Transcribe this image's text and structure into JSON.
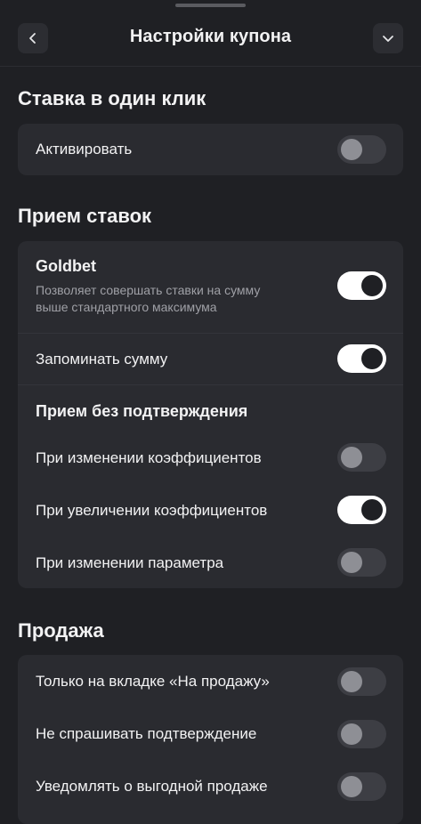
{
  "header": {
    "title": "Настройки купона",
    "back_icon": "chevron-left-icon",
    "collapse_icon": "chevron-down-icon"
  },
  "one_click": {
    "title": "Ставка в один клик",
    "activate_label": "Активировать",
    "activate_on": false
  },
  "accept": {
    "title": "Прием ставок",
    "goldbet_label": "Goldbet",
    "goldbet_desc_1": "Позволяет совершать ставки на сумму",
    "goldbet_desc_2": "выше стандартного максимума",
    "goldbet_on": true,
    "remember_label": "Запоминать сумму",
    "remember_on": true,
    "no_confirm_title": "Прием без подтверждения",
    "items": [
      {
        "label": "При изменении коэффициентов",
        "on": false
      },
      {
        "label": "При увеличении коэффициентов",
        "on": true
      },
      {
        "label": "При изменении параметра",
        "on": false
      }
    ]
  },
  "sale": {
    "title": "Продажа",
    "items": [
      {
        "label": "Только на вкладке «На продажу»",
        "on": false
      },
      {
        "label": "Не спрашивать подтверждение",
        "on": false
      },
      {
        "label": "Уведомлять о выгодной продаже",
        "on": false
      }
    ]
  },
  "colors": {
    "background": "#1f2024",
    "card": "#2a2b30",
    "toggle_on": "#ffffff",
    "toggle_off": "#3d3e44"
  }
}
